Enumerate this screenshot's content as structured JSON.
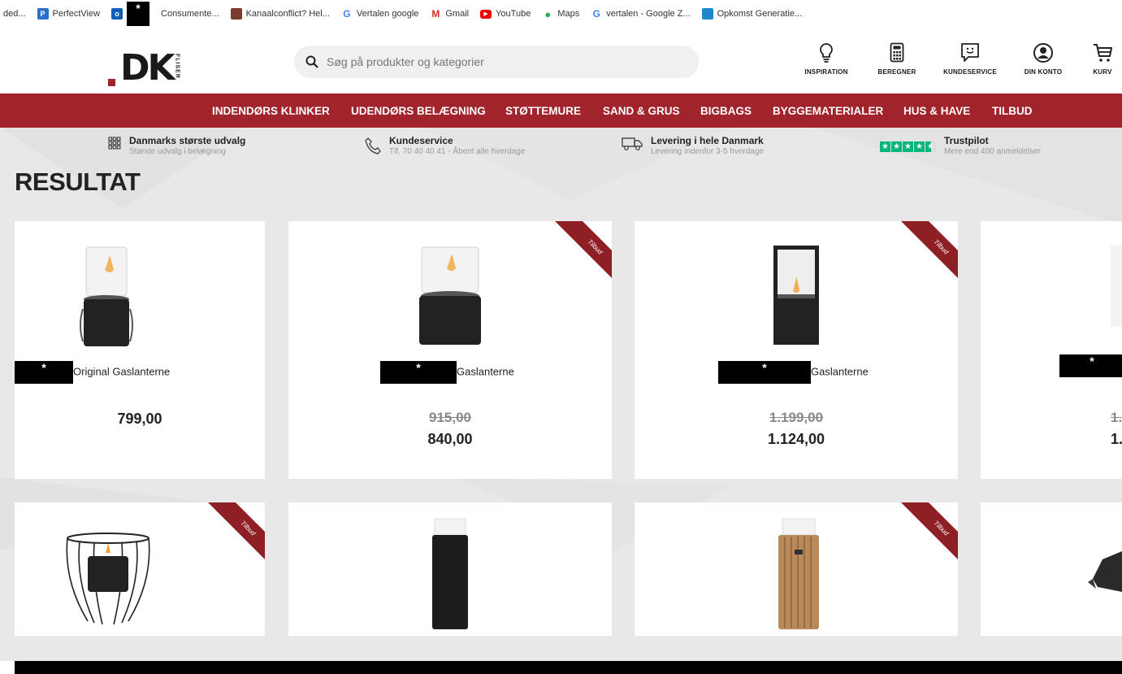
{
  "bookmarks": [
    {
      "label": "ded...",
      "icon": "none"
    },
    {
      "label": "PerfectView",
      "icon": "perfectview-icon",
      "color": "#2a6fc9",
      "glyph": "P"
    },
    {
      "label": "*",
      "icon": "outlook-icon",
      "color": "#0f5eb8",
      "redacted": true
    },
    {
      "label": "Consumente...",
      "icon": "none"
    },
    {
      "label": "Kanaalconflict? Hel...",
      "icon": "site-icon",
      "color": "#7a3b2a"
    },
    {
      "label": "Vertalen google",
      "icon": "google-icon"
    },
    {
      "label": "Gmail",
      "icon": "gmail-icon"
    },
    {
      "label": "YouTube",
      "icon": "youtube-icon"
    },
    {
      "label": "Maps",
      "icon": "maps-icon"
    },
    {
      "label": "vertalen - Google Z...",
      "icon": "google-icon"
    },
    {
      "label": "Opkomst Generatie...",
      "icon": "site-icon",
      "color": "#1e88c9"
    }
  ],
  "header": {
    "logo_text": "DK",
    "logo_sub": "FLISER",
    "search_placeholder": "Søg på produkter og kategorier",
    "icons": [
      {
        "label": "INSPIRATION",
        "icon": "lightbulb-icon"
      },
      {
        "label": "BEREGNER",
        "icon": "calculator-icon"
      },
      {
        "label": "KUNDESERVICE",
        "icon": "chat-icon"
      },
      {
        "label": "DIN KONTO",
        "icon": "user-icon"
      },
      {
        "label": "KURV",
        "icon": "cart-icon"
      }
    ]
  },
  "nav": [
    "INDENDØRS KLINKER",
    "UDENDØRS BELÆGNING",
    "STØTTEMURE",
    "SAND & GRUS",
    "BIGBAGS",
    "BYGGEMATERIALER",
    "HUS & HAVE",
    "TILBUD"
  ],
  "usps": [
    {
      "title": "Danmarks største udvalg",
      "sub": "Største udvalg i belægning",
      "icon": "grid-icon"
    },
    {
      "title": "Kundeservice",
      "sub": "Tlf. 70 40 40 41 - Åbent alle hverdage",
      "icon": "phone-icon"
    },
    {
      "title": "Levering i hele Danmark",
      "sub": "Levering indenfor 3-5 hverdage",
      "icon": "truck-icon"
    },
    {
      "title": "Trustpilot",
      "sub": "Mere end 400 anmeldelser",
      "icon": "trustpilot-stars-icon"
    }
  ],
  "page_title": "RESULTAT",
  "ribbon_label": "Tilbud",
  "redaction_mark": "*",
  "products": [
    {
      "name": "Original Gaslanterne",
      "old_price": "",
      "price": "799,00",
      "tilbud": false
    },
    {
      "name": "Gaslanterne",
      "old_price": "915,00",
      "price": "840,00",
      "tilbud": true
    },
    {
      "name": "Gaslanterne",
      "old_price": "1.199,00",
      "price": "1.124,00",
      "tilbud": true
    },
    {
      "name": "",
      "old_price": "1.",
      "price": "1.",
      "tilbud": false
    }
  ],
  "colors": {
    "brand_red": "#a1232b",
    "ribbon_red": "#8e1f25",
    "trustpilot_green": "#00b67a"
  }
}
